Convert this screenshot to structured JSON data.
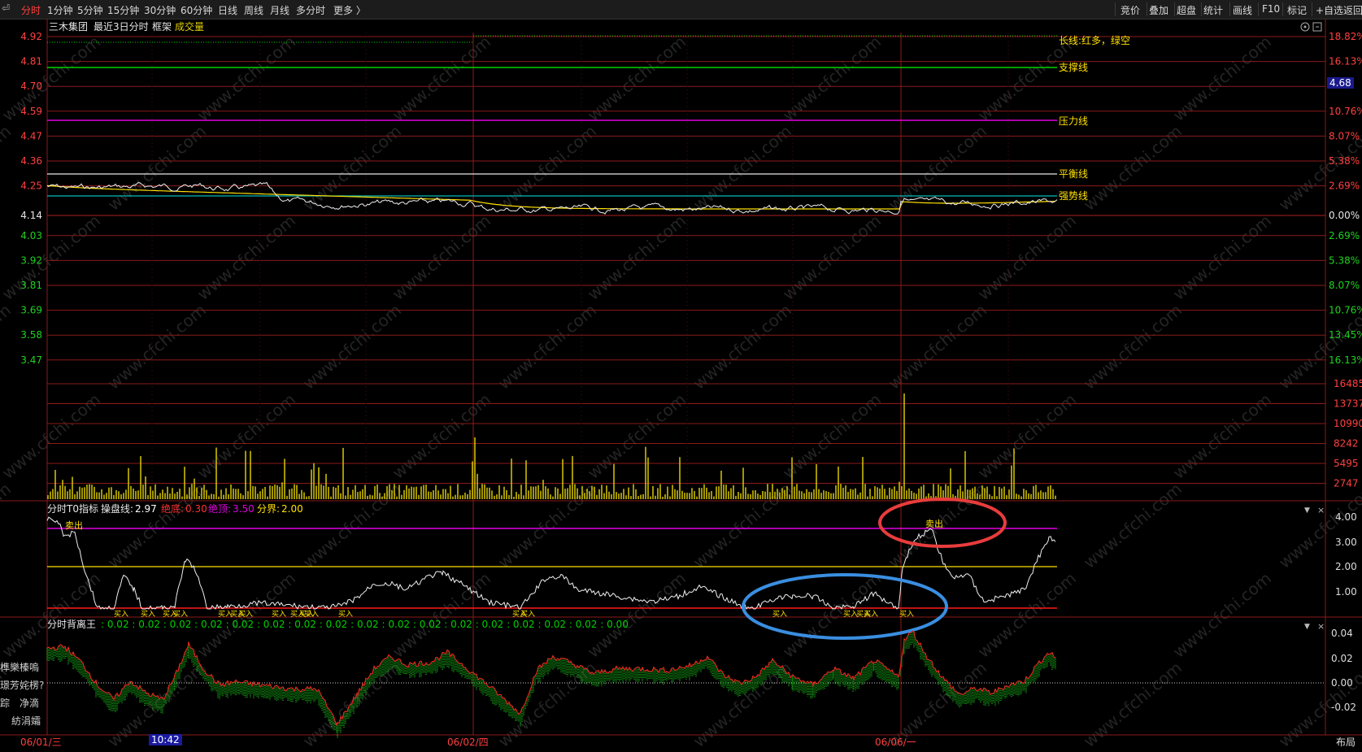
{
  "toolbar": {
    "back_glyph": "⏎",
    "left": [
      "分时",
      "1分钟",
      "5分钟",
      "15分钟",
      "30分钟",
      "60分钟",
      "日线",
      "周线",
      "月线",
      "多分时",
      "更多 〉"
    ],
    "right": [
      "竞价",
      "叠加",
      "超盘",
      "统计",
      "画线",
      "F10",
      "标记",
      "+自选",
      "返回"
    ]
  },
  "header": {
    "stock_name": "三木集团",
    "period": "最近3日分时",
    "frame": "框架",
    "volume_label": "成交量"
  },
  "price_axis": {
    "left": [
      "4.92",
      "4.81",
      "4.70",
      "4.59",
      "4.47",
      "4.36",
      "4.25",
      "4.14",
      "4.03",
      "3.92",
      "3.81",
      "3.69",
      "3.58",
      "3.47"
    ],
    "right": [
      "18.82%",
      "16.13%",
      "",
      "10.76%",
      "8.07%",
      "5.38%",
      "2.69%",
      "0.00%",
      "2.69%",
      "5.38%",
      "8.07%",
      "10.76%",
      "13.45%",
      "16.13%"
    ],
    "current_price": "4.68"
  },
  "volume_axis": [
    "16485",
    "13737",
    "10990",
    "8242",
    "5495",
    "2747"
  ],
  "line_labels": {
    "long": "长线:红多，绿空",
    "support": "支撑线",
    "pressure": "压力线",
    "balance": "平衡线",
    "strong": "强势线"
  },
  "indicator1": {
    "title": "分时T0指标",
    "operate_label": "操盘线:",
    "operate_value": "2.97",
    "bottom_label": "绝底:",
    "bottom_value": "0.30",
    "top_label": "绝顶:",
    "top_value": "3.50",
    "border_label": "分界:",
    "border_value": "2.00",
    "axis": [
      "4.00",
      "3.00",
      "2.00",
      "1.00"
    ],
    "sell_label": "卖出",
    "buy_label": "买入"
  },
  "indicator2": {
    "title": "分时背离王",
    "values": ": 0.02 : 0.02 : 0.02 : 0.02 : 0.02 : 0.02 : 0.02 : 0.02 : 0.02 : 0.02 : 0.02 : 0.02 : 0.02 : 0.02 : 0.02 : 0.02 : 0.00",
    "axis": [
      "0.04",
      "0.02",
      "0.00",
      "-0.02"
    ]
  },
  "left_menu": [
    "榫樂榛嗚",
    "璟芳姹楞?",
    "踪",
    "净滴",
    "紡涓孀"
  ],
  "time_axis": {
    "dates": [
      "06/01/三",
      "06/02/四",
      "06/06/一"
    ],
    "cursor_time": "10:42",
    "layout_label": "布局"
  },
  "watermark": "www.cfchi.com",
  "colors": {
    "grid_red": "#8b1a1a",
    "support_green": "#00d000",
    "pressure_magenta": "#e000e0",
    "balance_white": "#e8e8e8",
    "strong_cyan": "#00b8b8",
    "price_yellow": "#ffe000",
    "volume_yellow": "#d8c800",
    "highlight_red": "#e83c3c",
    "highlight_blue": "#3a8ee0"
  }
}
